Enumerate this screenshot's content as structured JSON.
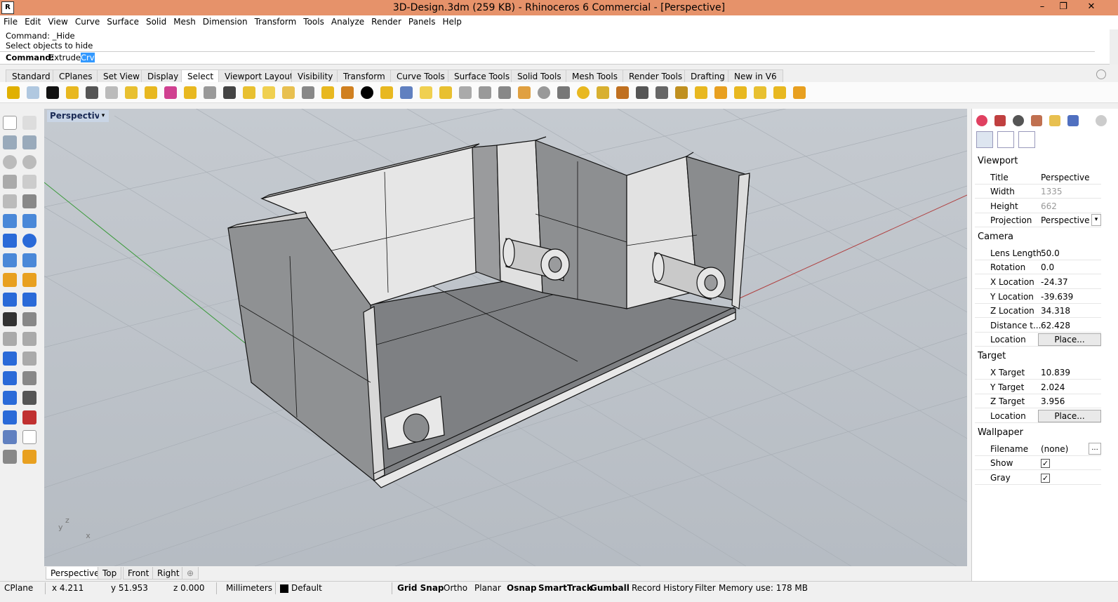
{
  "window": {
    "title": "3D-Design.3dm (259 KB) - Rhinoceros 6 Commercial - [Perspective]",
    "minimize_glyph": "–",
    "restore_glyph": "❐",
    "close_glyph": "✕"
  },
  "menu": [
    "File",
    "Edit",
    "View",
    "Curve",
    "Surface",
    "Solid",
    "Mesh",
    "Dimension",
    "Transform",
    "Tools",
    "Analyze",
    "Render",
    "Panels",
    "Help"
  ],
  "command": {
    "history_1": "Command: _Hide",
    "history_2": "Select objects to hide",
    "prompt_label": "Command:",
    "current_prefix": "Extrude",
    "current_highlight": "Crv"
  },
  "toolbar_tabs": [
    "Standard",
    "CPlanes",
    "Set View",
    "Display",
    "Select",
    "Viewport Layout",
    "Visibility",
    "Transform",
    "Curve Tools",
    "Surface Tools",
    "Solid Tools",
    "Mesh Tools",
    "Render Tools",
    "Drafting",
    "New in V6"
  ],
  "active_toolbar_tab": "Select",
  "viewport": {
    "name": "Perspective",
    "dropdown_glyph": "▾",
    "axis_x": "x",
    "axis_y": "y",
    "axis_z": "z"
  },
  "viewport_tabs": [
    "Perspective",
    "Top",
    "Front",
    "Right"
  ],
  "add_tab_glyph": "⊕",
  "status": {
    "cplane": "CPlane",
    "x": "x 4.211",
    "y": "y 51.953",
    "z": "z 0.000",
    "units": "Millimeters",
    "layer": "Default",
    "grid_snap": "Grid Snap",
    "ortho": "Ortho",
    "planar": "Planar",
    "osnap": "Osnap",
    "smarttrack": "SmartTrack",
    "gumball": "Gumball",
    "record_history": "Record History",
    "filter": "Filter",
    "memory": "Memory use: 178 MB"
  },
  "panel": {
    "viewport_section": "Viewport",
    "camera_section": "Camera",
    "target_section": "Target",
    "wallpaper_section": "Wallpaper",
    "viewport_rows": [
      {
        "label": "Title",
        "value": "Perspective"
      },
      {
        "label": "Width",
        "value": "1335"
      },
      {
        "label": "Height",
        "value": "662"
      },
      {
        "label": "Projection",
        "value": "Perspective"
      }
    ],
    "camera_rows": [
      {
        "label": "Lens Length",
        "value": "50.0"
      },
      {
        "label": "Rotation",
        "value": "0.0"
      },
      {
        "label": "X Location",
        "value": "-24.37"
      },
      {
        "label": "Y Location",
        "value": "-39.639"
      },
      {
        "label": "Z Location",
        "value": "34.318"
      },
      {
        "label": "Distance t...",
        "value": "62.428"
      },
      {
        "label": "Location",
        "value": "Place..."
      }
    ],
    "target_rows": [
      {
        "label": "X Target",
        "value": "10.839"
      },
      {
        "label": "Y Target",
        "value": "2.024"
      },
      {
        "label": "Z Target",
        "value": "3.956"
      },
      {
        "label": "Location",
        "value": "Place..."
      }
    ],
    "wallpaper_rows": [
      {
        "label": "Filename",
        "value": "(none)"
      },
      {
        "label": "Show",
        "value": "✓"
      },
      {
        "label": "Gray",
        "value": "✓"
      }
    ],
    "browse_glyph": "..."
  },
  "colors": {
    "titlebar": "#e6926a",
    "viewport_bg": "#bcc2c9",
    "x_axis": "#b04040",
    "y_axis": "#3a9a3a"
  }
}
